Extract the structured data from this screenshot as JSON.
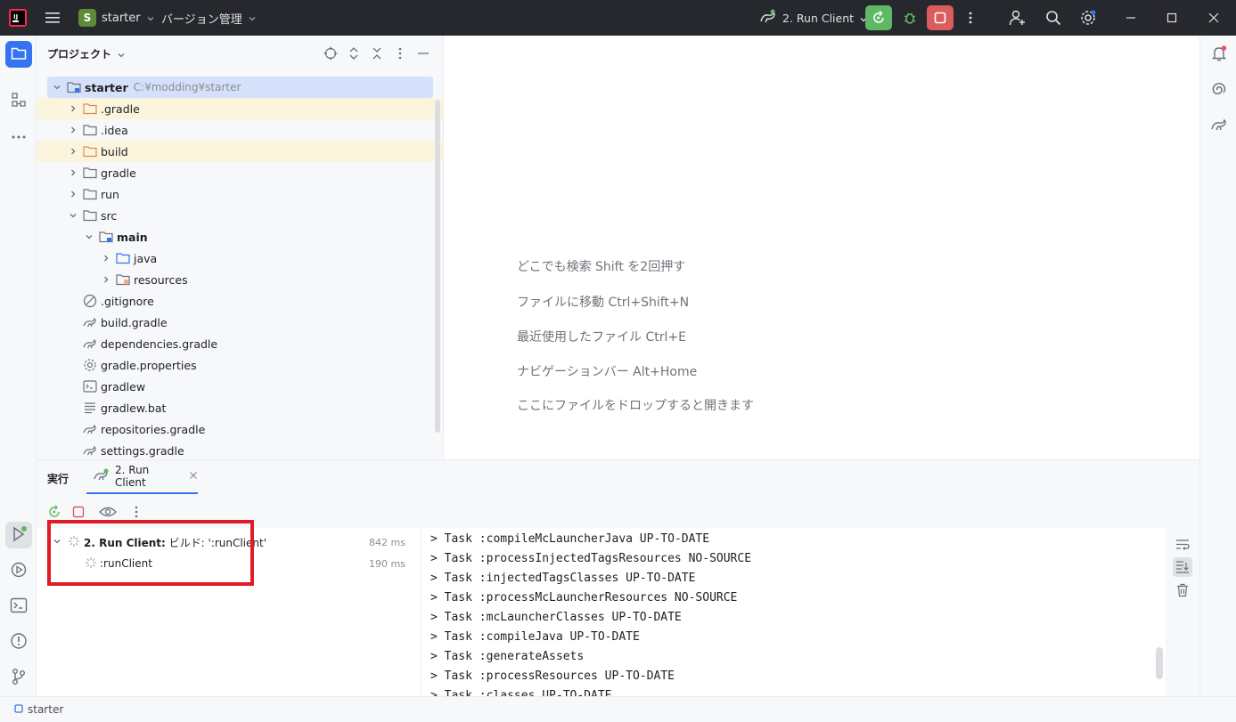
{
  "titlebar": {
    "project_badge": "S",
    "project_name": "starter",
    "vcs_label": "バージョン管理",
    "run_config": "2. Run Client"
  },
  "project_panel": {
    "title": "プロジェクト",
    "tree": [
      {
        "label": "starter",
        "path": "C:¥modding¥starter",
        "icon": "module-folder-icon"
      },
      {
        "label": ".gradle",
        "icon": "folder-excluded-icon"
      },
      {
        "label": ".idea",
        "icon": "folder-icon"
      },
      {
        "label": "build",
        "icon": "folder-excluded-icon"
      },
      {
        "label": "gradle",
        "icon": "folder-icon"
      },
      {
        "label": "run",
        "icon": "folder-icon"
      },
      {
        "label": "src",
        "icon": "folder-icon"
      },
      {
        "label": "main",
        "icon": "module-folder-icon"
      },
      {
        "label": "java",
        "icon": "source-folder-icon"
      },
      {
        "label": "resources",
        "icon": "resources-folder-icon"
      },
      {
        "label": ".gitignore",
        "icon": "ignore-file-icon"
      },
      {
        "label": "build.gradle",
        "icon": "gradle-icon"
      },
      {
        "label": "dependencies.gradle",
        "icon": "gradle-icon"
      },
      {
        "label": "gradle.properties",
        "icon": "gear-icon"
      },
      {
        "label": "gradlew",
        "icon": "terminal-icon"
      },
      {
        "label": "gradlew.bat",
        "icon": "text-file-icon"
      },
      {
        "label": "repositories.gradle",
        "icon": "gradle-icon"
      },
      {
        "label": "settings.gradle",
        "icon": "gradle-icon"
      }
    ]
  },
  "editor": {
    "hints": [
      "どこでも検索 Shift を2回押す",
      "ファイルに移動 Ctrl+Shift+N",
      "最近使用したファイル Ctrl+E",
      "ナビゲーションバー Alt+Home",
      "ここにファイルをドロップすると開きます"
    ]
  },
  "run_window": {
    "title": "実行",
    "tab_label": "2. Run Client",
    "tasks": [
      {
        "label_bold": "2. Run Client:",
        "label": " ビルド: ':runClient'",
        "time": "842 ms"
      },
      {
        "label_bold": "",
        "label": ":runClient",
        "time": "190 ms"
      }
    ],
    "console_lines": [
      "> Task :compileMcLauncherJava UP-TO-DATE",
      "> Task :processInjectedTagsResources NO-SOURCE",
      "> Task :injectedTagsClasses UP-TO-DATE",
      "> Task :processMcLauncherResources NO-SOURCE",
      "> Task :mcLauncherClasses UP-TO-DATE",
      "> Task :compileJava UP-TO-DATE",
      "> Task :generateAssets",
      "> Task :processResources UP-TO-DATE",
      "> Task :classes UP-TO-DATE"
    ]
  },
  "statusbar": {
    "breadcrumb": "starter"
  },
  "colors": {
    "accent": "#3574f0",
    "run_green": "#5fb865",
    "stop_red": "#db5c5c",
    "highlight_box": "#e11c24"
  }
}
